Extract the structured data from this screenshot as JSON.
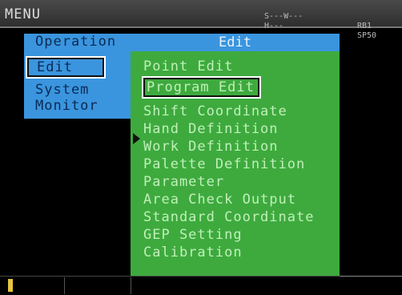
{
  "header": {
    "title": "MENU",
    "status_line1_left": "S---W---",
    "status_line1_right": "RB1",
    "status_line2_left": "H---",
    "status_line2_right": "SP50"
  },
  "left_menu": {
    "items": [
      "Operation",
      "Edit",
      "System",
      "Monitor"
    ],
    "selected": "Edit"
  },
  "submenu": {
    "header": "Edit",
    "items": [
      "Point Edit",
      "Program Edit",
      "Shift Coordinate",
      "Hand Definition",
      "Work Definition",
      "Palette Definition",
      "Parameter",
      "Area Check Output",
      "Standard Coordinate",
      "GEP Setting",
      "Calibration"
    ],
    "selected": "Program Edit"
  }
}
